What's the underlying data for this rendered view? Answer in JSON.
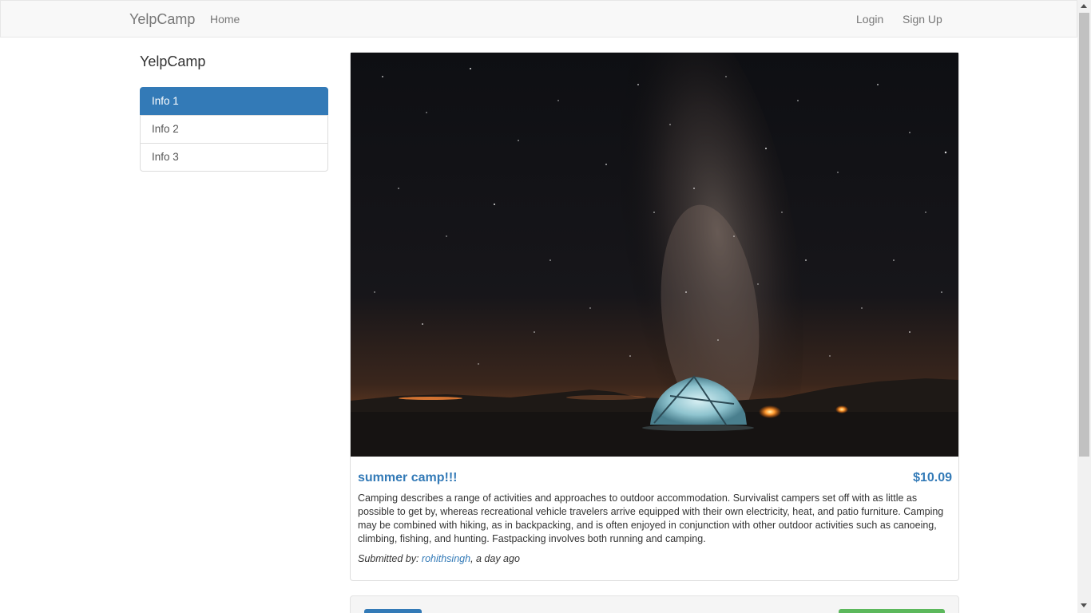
{
  "navbar": {
    "brand": "YelpCamp",
    "home": "Home",
    "login": "Login",
    "signup": "Sign Up"
  },
  "sidebar": {
    "title": "YelpCamp",
    "items": [
      {
        "label": "Info 1",
        "active": true
      },
      {
        "label": "Info 2",
        "active": false
      },
      {
        "label": "Info 3",
        "active": false
      }
    ]
  },
  "campground": {
    "name": "summer camp!!!",
    "price": "$10.09",
    "description": "Camping describes a range of activities and approaches to outdoor accommodation. Survivalist campers set off with as little as possible to get by, whereas recreational vehicle travelers arrive equipped with their own electricity, heat, and patio furniture. Camping may be combined with hiking, as in backpacking, and is often enjoyed in conjunction with other outdoor activities such as canoeing, climbing, fishing, and hunting. Fastpacking involves both running and camping.",
    "submitted_prefix": "Submitted by: ",
    "author": "rohithsingh",
    "time": ", a day ago",
    "image_subject": "night sky milky way over lit tent"
  },
  "colors": {
    "primary": "#337ab7",
    "success": "#5cb85c",
    "navbar_bg": "#f8f8f8"
  }
}
